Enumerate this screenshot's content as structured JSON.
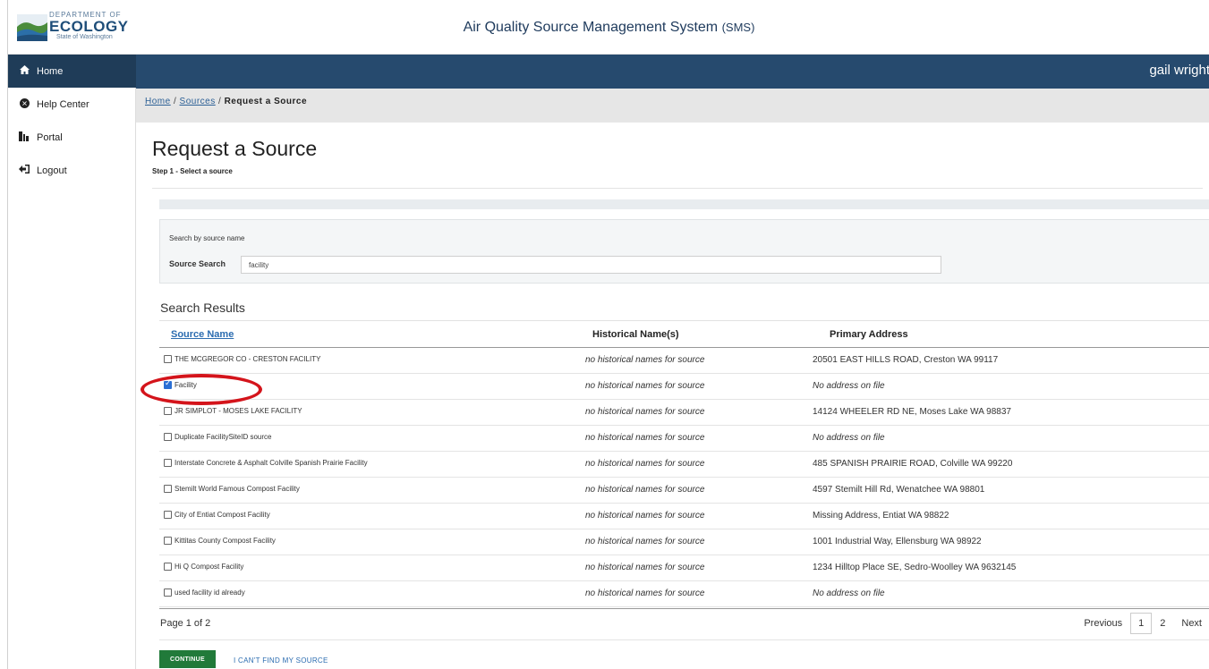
{
  "header": {
    "logo_line1": "DEPARTMENT OF",
    "logo_line2": "ECOLOGY",
    "logo_line3": "State of Washington",
    "app_title": "Air Quality Source Management System",
    "app_abbr": "(SMS)",
    "user_name": "gail wright"
  },
  "sidebar": {
    "items": [
      {
        "label": "Home",
        "icon": "home-icon"
      },
      {
        "label": "Help Center",
        "icon": "help-icon"
      },
      {
        "label": "Portal",
        "icon": "portal-icon"
      },
      {
        "label": "Logout",
        "icon": "logout-icon"
      }
    ]
  },
  "breadcrumb": {
    "home": "Home",
    "sep1": "/",
    "sources": "Sources",
    "sep2": "/",
    "current": "Request a Source"
  },
  "page": {
    "title": "Request a Source",
    "step": "Step 1 - Select a source"
  },
  "search": {
    "hint": "Search by source name",
    "label": "Source Search",
    "value": "facility"
  },
  "results": {
    "title": "Search Results",
    "columns": [
      "Source Name",
      "Historical Name(s)",
      "Primary Address"
    ],
    "rows": [
      {
        "name": "THE MCGREGOR CO - CRESTON FACILITY",
        "checked": false,
        "hist": "no historical names for source",
        "addr": "20501 EAST HILLS ROAD, Creston WA 99117"
      },
      {
        "name": "Facility",
        "checked": true,
        "hist": "no historical names for source",
        "addr": "No address on file"
      },
      {
        "name": "JR SIMPLOT - MOSES LAKE FACILITY",
        "checked": false,
        "hist": "no historical names for source",
        "addr": "14124 WHEELER RD NE, Moses Lake WA 98837"
      },
      {
        "name": "Duplicate FacilitySiteID source",
        "checked": false,
        "hist": "no historical names for source",
        "addr": "No address on file"
      },
      {
        "name": "Interstate Concrete & Asphalt Colville Spanish Prairie Facility",
        "checked": false,
        "hist": "no historical names for source",
        "addr": "485 SPANISH PRAIRIE ROAD, Colville WA 99220"
      },
      {
        "name": "Stemilt World Famous Compost Facility",
        "checked": false,
        "hist": "no historical names for source",
        "addr": "4597 Stemilt Hill Rd, Wenatchee WA 98801"
      },
      {
        "name": "City of Entiat Compost Facility",
        "checked": false,
        "hist": "no historical names for source",
        "addr": "Missing Address, Entiat WA 98822"
      },
      {
        "name": "Kittitas County Compost Facility",
        "checked": false,
        "hist": "no historical names for source",
        "addr": "1001 Industrial Way, Ellensburg WA 98922"
      },
      {
        "name": "Hi Q Compost Facility",
        "checked": false,
        "hist": "no historical names for source",
        "addr": "1234 Hilltop Place SE, Sedro-Woolley WA 9632145"
      },
      {
        "name": "used facility id already",
        "checked": false,
        "hist": "no historical names for source",
        "addr": "No address on file"
      }
    ]
  },
  "pagination": {
    "info": "Page 1 of 2",
    "previous": "Previous",
    "pages": [
      "1",
      "2"
    ],
    "current": "1",
    "next": "Next"
  },
  "actions": {
    "continue": "CONTINUE",
    "cant_find": "I CAN'T FIND MY SOURCE"
  },
  "colors": {
    "nav_dark": "#1f3c58",
    "nav_band": "#264a6e",
    "continue_green": "#217a3a",
    "link_blue": "#2b6cb0",
    "annotation_red": "#d4141b"
  }
}
